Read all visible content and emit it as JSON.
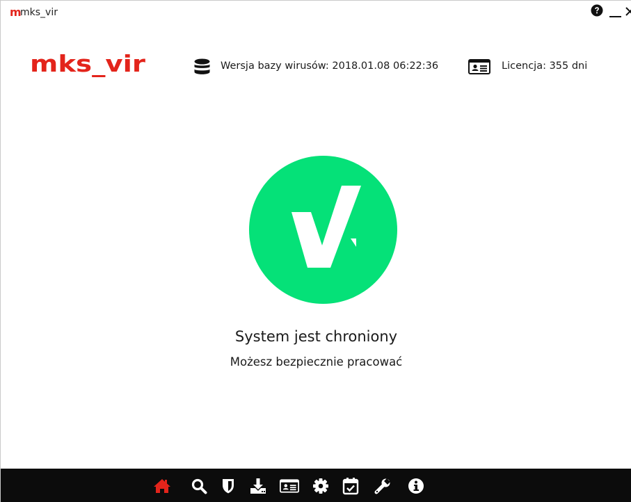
{
  "window": {
    "title": "mks_vir",
    "title_logo": "m",
    "controls": [
      "help-icon",
      "minimize-icon",
      "close-icon"
    ]
  },
  "header": {
    "logo_text": "mks_vir",
    "database": {
      "icon": "database-icon",
      "text": "Wersja bazy wirusów: 2018.01.08 06:22:36"
    },
    "license": {
      "icon": "id-card-icon",
      "text": "Licencja: 355 dni"
    }
  },
  "status": {
    "icon": "checkmark-icon",
    "title": "System jest chroniony",
    "subtitle": "Możesz bezpiecznie pracować",
    "color": "#05e178"
  },
  "nav": {
    "active": "home",
    "active_color": "#e3241b",
    "items": [
      {
        "id": "home",
        "icon": "home-icon"
      },
      {
        "id": "scan",
        "icon": "search-icon"
      },
      {
        "id": "protection",
        "icon": "shield-icon"
      },
      {
        "id": "update",
        "icon": "download-icon"
      },
      {
        "id": "license",
        "icon": "id-card-icon"
      },
      {
        "id": "settings",
        "icon": "gear-icon"
      },
      {
        "id": "scheduler",
        "icon": "calendar-check-icon"
      },
      {
        "id": "tools",
        "icon": "wrench-icon"
      },
      {
        "id": "about",
        "icon": "info-icon"
      }
    ]
  },
  "colors": {
    "brand": "#e3241b",
    "status_ok": "#05e178",
    "nav_bg": "#0c0c0c",
    "nav_icon": "#ffffff"
  }
}
